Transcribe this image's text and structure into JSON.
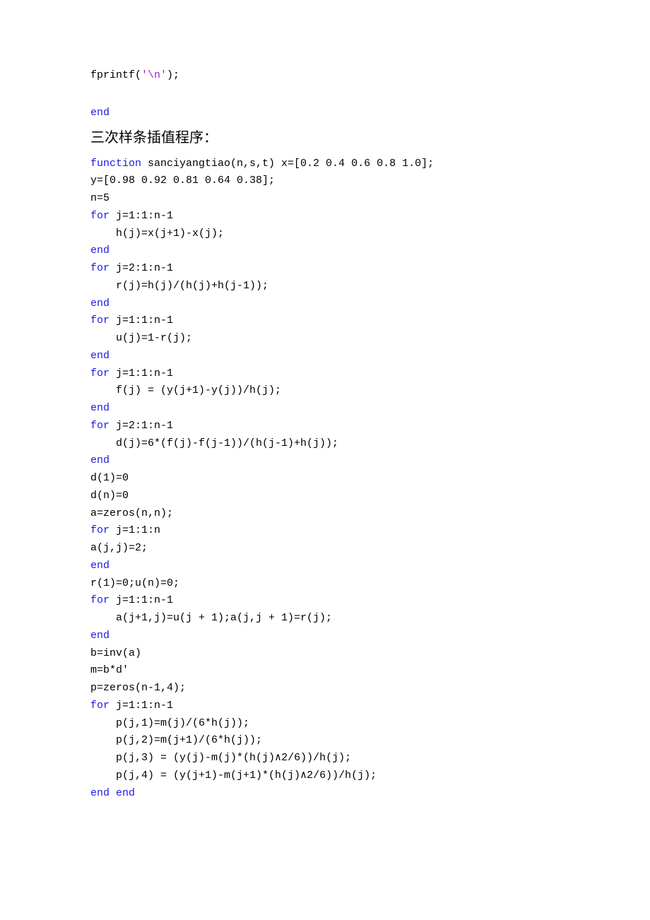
{
  "code1": [
    [
      {
        "text": "fprintf(",
        "cls": "c-plain"
      },
      {
        "text": "'\\n'",
        "cls": "c-string"
      },
      {
        "text": ");",
        "cls": "c-plain"
      }
    ]
  ],
  "code1b": [
    [
      {
        "text": "end",
        "cls": "c-keyword"
      }
    ]
  ],
  "heading": "三次样条插值程序：",
  "code2": [
    [
      {
        "text": "function ",
        "cls": "c-keyword"
      },
      {
        "text": "sanciyangtiao(n,s,t) x=[0.2 0.4 0.6 0.8 1.0];",
        "cls": "c-plain"
      }
    ],
    [
      {
        "text": "y=[0.98 0.92 0.81 0.64 0.38];",
        "cls": "c-plain"
      }
    ],
    [
      {
        "text": "n=5",
        "cls": "c-plain"
      }
    ],
    [
      {
        "text": "for ",
        "cls": "c-keyword"
      },
      {
        "text": "j=1:1:n-1",
        "cls": "c-plain"
      }
    ],
    [
      {
        "text": "    h(j)=x(j+1)-x(j);",
        "cls": "c-plain"
      }
    ],
    [
      {
        "text": "end",
        "cls": "c-keyword"
      }
    ],
    [
      {
        "text": "for ",
        "cls": "c-keyword"
      },
      {
        "text": "j=2:1:n-1",
        "cls": "c-plain"
      }
    ],
    [
      {
        "text": "    r(j)=h(j)/(h(j)+h(j-1));",
        "cls": "c-plain"
      }
    ],
    [
      {
        "text": "end",
        "cls": "c-keyword"
      }
    ],
    [
      {
        "text": "for ",
        "cls": "c-keyword"
      },
      {
        "text": "j=1:1:n-1",
        "cls": "c-plain"
      }
    ],
    [
      {
        "text": "    u(j)=1-r(j);",
        "cls": "c-plain"
      }
    ],
    [
      {
        "text": "end",
        "cls": "c-keyword"
      }
    ],
    [
      {
        "text": "for ",
        "cls": "c-keyword"
      },
      {
        "text": "j=1:1:n-1",
        "cls": "c-plain"
      }
    ],
    [
      {
        "text": "    f(j) = (y(j+1)-y(j))/h(j);",
        "cls": "c-plain"
      }
    ],
    [
      {
        "text": "end",
        "cls": "c-keyword"
      }
    ],
    [
      {
        "text": "for ",
        "cls": "c-keyword"
      },
      {
        "text": "j=2:1:n-1",
        "cls": "c-plain"
      }
    ],
    [
      {
        "text": "    d(j)=6*(f(j)-f(j-1))/(h(j-1)+h(j));",
        "cls": "c-plain"
      }
    ],
    [
      {
        "text": "end",
        "cls": "c-keyword"
      }
    ],
    [
      {
        "text": "d(1)=0",
        "cls": "c-plain"
      }
    ],
    [
      {
        "text": "d(n)=0",
        "cls": "c-plain"
      }
    ],
    [
      {
        "text": "a=zeros(n,n);",
        "cls": "c-plain"
      }
    ],
    [
      {
        "text": "for ",
        "cls": "c-keyword"
      },
      {
        "text": "j=1:1:n",
        "cls": "c-plain"
      }
    ],
    [
      {
        "text": "a(j,j)=2;",
        "cls": "c-plain"
      }
    ],
    [
      {
        "text": "end",
        "cls": "c-keyword"
      }
    ],
    [
      {
        "text": "r(1)=0;u(n)=0;",
        "cls": "c-plain"
      }
    ],
    [
      {
        "text": "for ",
        "cls": "c-keyword"
      },
      {
        "text": "j=1:1:n-1",
        "cls": "c-plain"
      }
    ],
    [
      {
        "text": "    a(j+1,j)=u(j + 1);a(j,j + 1)=r(j);",
        "cls": "c-plain"
      }
    ],
    [
      {
        "text": "end",
        "cls": "c-keyword"
      }
    ],
    [
      {
        "text": "b=inv(a)",
        "cls": "c-plain"
      }
    ],
    [
      {
        "text": "m=b*d'",
        "cls": "c-plain"
      }
    ],
    [
      {
        "text": "p=zeros(n-1,4);",
        "cls": "c-plain"
      }
    ],
    [
      {
        "text": "for ",
        "cls": "c-keyword"
      },
      {
        "text": "j=1:1:n-1",
        "cls": "c-plain"
      }
    ],
    [
      {
        "text": "    p(j,1)=m(j)/(6*h(j));",
        "cls": "c-plain"
      }
    ],
    [
      {
        "text": "    p(j,2)=m(j+1)/(6*h(j));",
        "cls": "c-plain"
      }
    ],
    [
      {
        "text": "    p(j,3) = (y(j)-m(j)*(h(j)∧2/6))/h(j);",
        "cls": "c-plain"
      }
    ],
    [
      {
        "text": "    p(j,4) = (y(j+1)-m(j+1)*(h(j)∧2/6))/h(j);",
        "cls": "c-plain"
      }
    ],
    [
      {
        "text": "end end",
        "cls": "c-keyword"
      }
    ]
  ]
}
